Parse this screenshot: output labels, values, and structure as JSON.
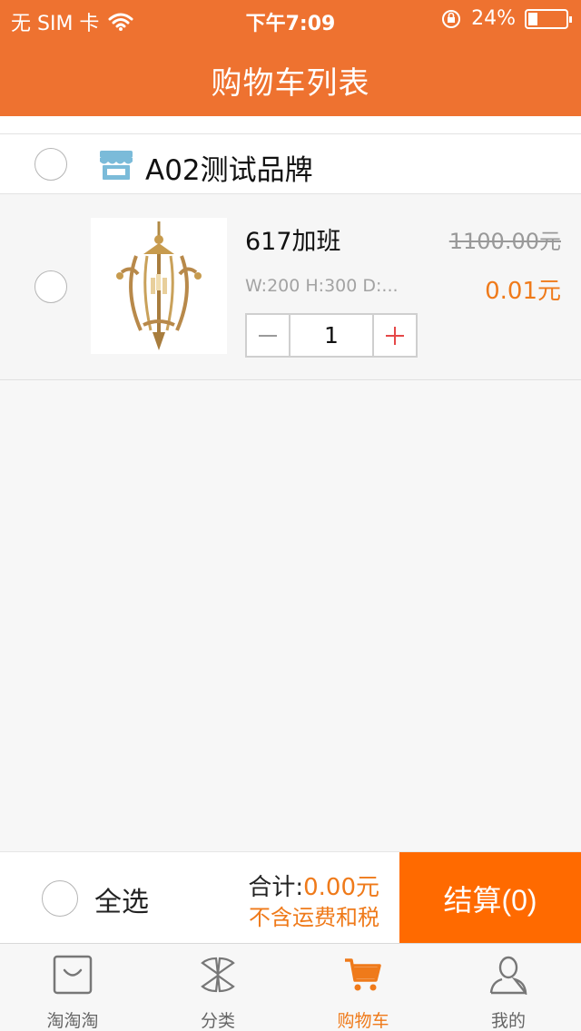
{
  "status_bar": {
    "carrier": "无 SIM 卡",
    "time": "下午7:09",
    "battery_text": "24%",
    "battery_level": 0.24
  },
  "header": {
    "title": "购物车列表"
  },
  "store": {
    "name": "A02测试品牌",
    "icon": "store-icon"
  },
  "cart_item": {
    "name": "617加班",
    "original_price": "1100.00元",
    "price": "0.01元",
    "spec": "W:200 H:300 D:...",
    "quantity": "1",
    "image": "brass-chandelier"
  },
  "bottom_bar": {
    "select_all": "全选",
    "total_label": "合计:",
    "total_amount": "0.00元",
    "tax_note": "不含运费和税",
    "checkout_label": "结算(0)"
  },
  "tabbar": {
    "items": [
      {
        "label": "淘淘淘",
        "icon": "shopping-bag-icon"
      },
      {
        "label": "分类",
        "icon": "category-icon"
      },
      {
        "label": "购物车",
        "icon": "cart-icon"
      },
      {
        "label": "我的",
        "icon": "user-icon"
      }
    ],
    "active_index": 2
  },
  "colors": {
    "header": "#ee7230",
    "accent": "#ef7a1a",
    "checkout": "#ff6a00",
    "store_icon": "#7bbbd9"
  }
}
